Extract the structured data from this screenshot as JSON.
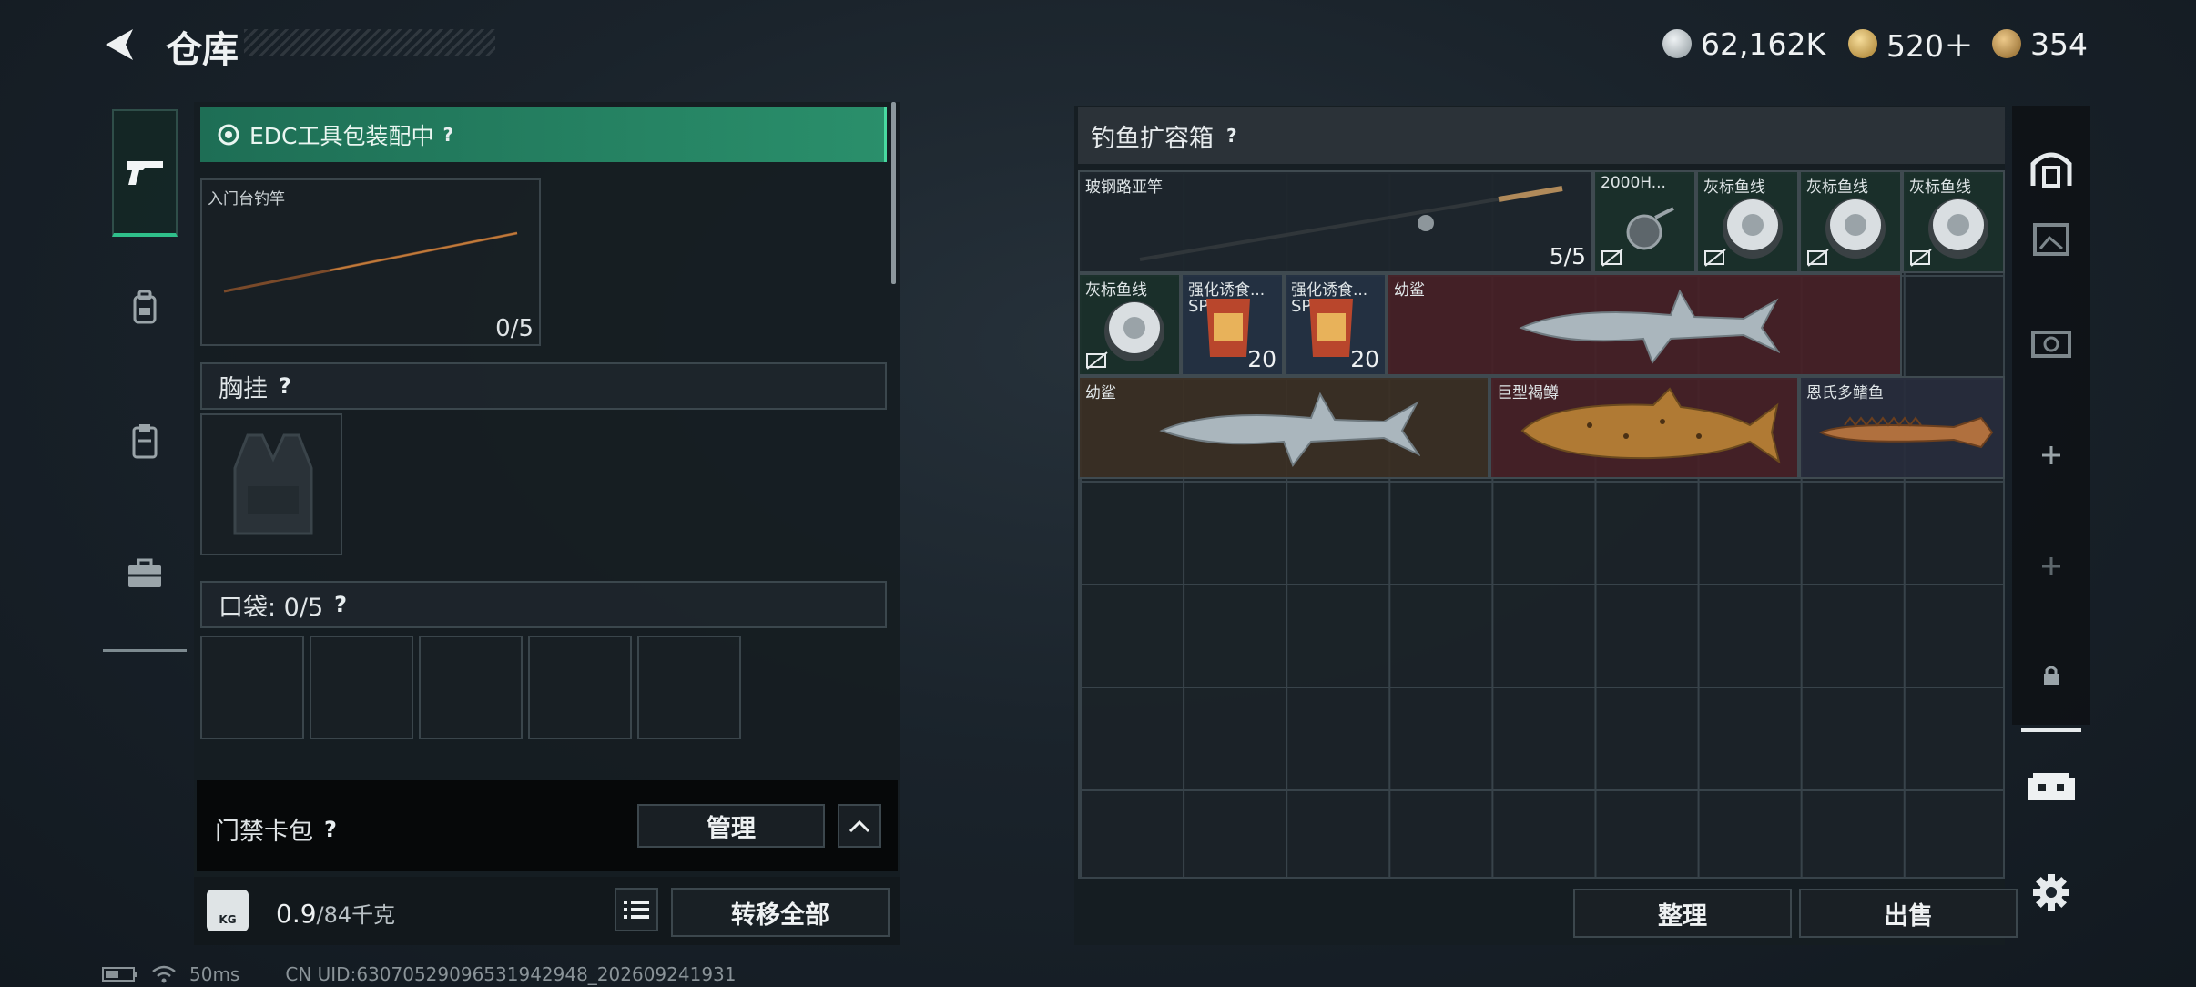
{
  "header": {
    "title": "仓库",
    "currencies": [
      {
        "name": "silver-coin",
        "value": "62,162K",
        "color": "#b9c2c7"
      },
      {
        "name": "gold-token",
        "value": "520＋",
        "color": "#d3a84a"
      },
      {
        "name": "bronze-token",
        "value": "354",
        "color": "#c69a4e"
      }
    ]
  },
  "left_rail": {
    "tabs": [
      {
        "icon": "pistol-icon",
        "active": true
      },
      {
        "icon": "backpack-icon",
        "active": false
      },
      {
        "icon": "clipboard-icon",
        "active": false
      },
      {
        "icon": "toolbox-icon",
        "active": false
      }
    ]
  },
  "loadout": {
    "edc_label": "EDC工具包装配中",
    "help": "?",
    "rod_slot": {
      "name": "入门台钓竿",
      "count": "0/5"
    },
    "chest_rig_label": "胸挂",
    "pocket_label": "口袋: 0/5",
    "keycard_label": "门禁卡包",
    "manage_button": "管理",
    "weight_value": "0.9",
    "weight_max": "/84千克",
    "weight_icon_text": "KG",
    "transfer_all_button": "转移全部"
  },
  "container": {
    "title": "钓鱼扩容箱",
    "items": [
      {
        "name": "玻钢路亚竿",
        "count": "5/5"
      },
      {
        "name": "2000H...",
        "count": ""
      },
      {
        "name": "灰标鱼线",
        "count": ""
      },
      {
        "name": "灰标鱼线",
        "count": ""
      },
      {
        "name": "灰标鱼线",
        "count": ""
      },
      {
        "name": "灰标鱼线",
        "count": ""
      },
      {
        "name": "强化诱食...",
        "count": "20",
        "tag": "SP"
      },
      {
        "name": "强化诱食...",
        "count": "20",
        "tag": "SP"
      },
      {
        "name": "幼鲨",
        "count": ""
      },
      {
        "name": "幼鲨",
        "count": ""
      },
      {
        "name": "巨型褐鳟",
        "count": ""
      },
      {
        "name": "恩氏多鳍鱼",
        "count": ""
      }
    ],
    "sort_button": "整理",
    "sell_button": "出售"
  },
  "status": {
    "ping": "50ms",
    "uid": "CN UID:6307052909653194294​8_202609241931"
  }
}
